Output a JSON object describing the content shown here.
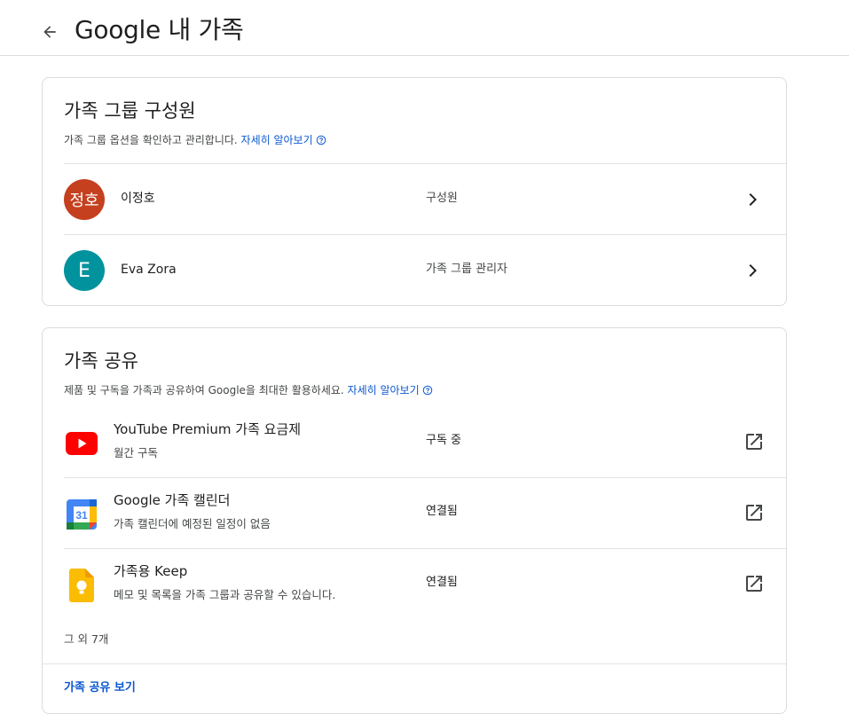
{
  "header": {
    "title": "Google 내 가족"
  },
  "members_section": {
    "title": "가족 그룹 구성원",
    "description": "가족 그룹 옵션을 확인하고 관리합니다.",
    "learn_more": "자세히 알아보기",
    "members": [
      {
        "avatar_text": "정호",
        "avatar_color": "#c5401f",
        "name": "이정호",
        "role": "구성원"
      },
      {
        "avatar_text": "E",
        "avatar_color": "#00939e",
        "name": "Eva Zora",
        "role": "가족 그룹 관리자"
      }
    ]
  },
  "sharing_section": {
    "title": "가족 공유",
    "description": "제품 및 구독을 가족과 공유하여 Google을 최대한 활용하세요.",
    "learn_more": "자세히 알아보기",
    "items": [
      {
        "icon": "youtube-icon",
        "name": "YouTube Premium 가족 요금제",
        "subtitle": "월간 구독",
        "status": "구독 중"
      },
      {
        "icon": "calendar-icon",
        "calendar_day": "31",
        "name": "Google 가족 캘린더",
        "subtitle": "가족 캘린더에 예정된 일정이 없음",
        "status": "연결됨"
      },
      {
        "icon": "keep-icon",
        "name": "가족용 Keep",
        "subtitle": "메모 및 목록을 가족 그룹과 공유할 수 있습니다.",
        "status": "연결됨"
      }
    ],
    "more_count": "그 외 7개",
    "view_all": "가족 공유 보기"
  },
  "colors": {
    "link": "#0b57d0",
    "divider": "#e3e3e3",
    "border": "#dadce0"
  }
}
